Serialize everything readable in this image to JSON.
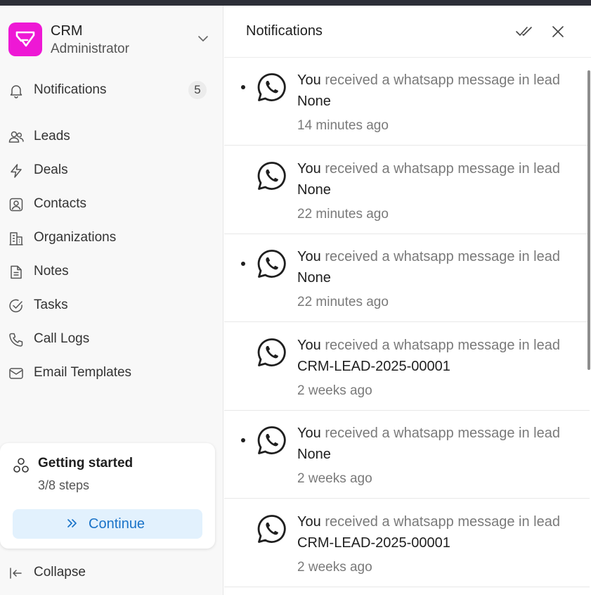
{
  "sidebar": {
    "app_name": "CRM",
    "role": "Administrator",
    "nav": [
      {
        "label": "Notifications",
        "icon": "bell-icon",
        "badge": "5"
      },
      {
        "label": "Leads",
        "icon": "users-icon"
      },
      {
        "label": "Deals",
        "icon": "lightning-icon"
      },
      {
        "label": "Contacts",
        "icon": "contact-card-icon"
      },
      {
        "label": "Organizations",
        "icon": "building-icon"
      },
      {
        "label": "Notes",
        "icon": "note-icon"
      },
      {
        "label": "Tasks",
        "icon": "check-circle-icon"
      },
      {
        "label": "Call Logs",
        "icon": "phone-icon"
      },
      {
        "label": "Email Templates",
        "icon": "mail-icon"
      }
    ],
    "getting_started": {
      "title": "Getting started",
      "steps": "3/8 steps",
      "button": "Continue"
    },
    "collapse_label": "Collapse"
  },
  "notifications": {
    "title": "Notifications",
    "items": [
      {
        "actor": "You",
        "text": "received a whatsapp message in lead",
        "ref": "None",
        "time": "14 minutes ago",
        "unread": true
      },
      {
        "actor": "You",
        "text": "received a whatsapp message in lead",
        "ref": "None",
        "time": "22 minutes ago",
        "unread": false
      },
      {
        "actor": "You",
        "text": "received a whatsapp message in lead",
        "ref": "None",
        "time": "22 minutes ago",
        "unread": true
      },
      {
        "actor": "You",
        "text": "received a whatsapp message in lead",
        "ref": "CRM-LEAD-2025-00001",
        "time": "2 weeks ago",
        "unread": false
      },
      {
        "actor": "You",
        "text": "received a whatsapp message in lead",
        "ref": "None",
        "time": "2 weeks ago",
        "unread": true
      },
      {
        "actor": "You",
        "text": "received a whatsapp message in lead",
        "ref": "CRM-LEAD-2025-00001",
        "time": "2 weeks ago",
        "unread": false
      }
    ]
  },
  "colors": {
    "brand": "#ee18d5",
    "continue_bg": "#e2f1fd",
    "continue_text": "#1a73c8"
  }
}
